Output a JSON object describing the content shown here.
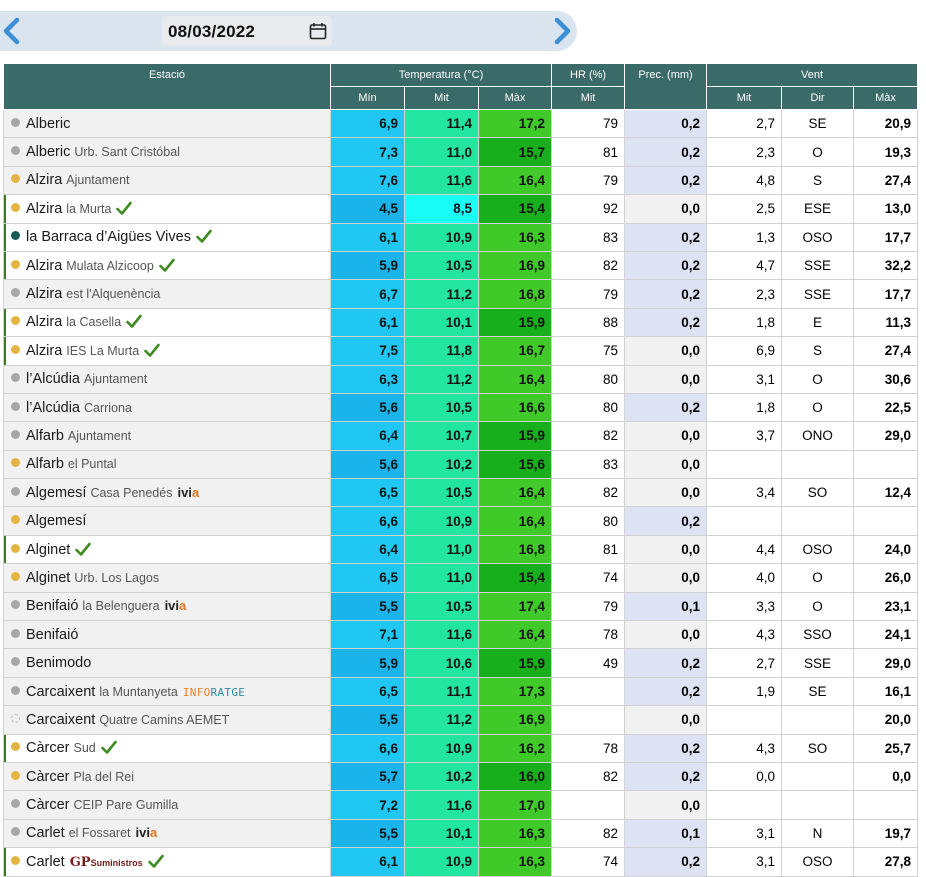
{
  "date": {
    "value": "08/03/2022"
  },
  "icons": {
    "prev": "chevron-left-icon",
    "next": "chevron-right-icon",
    "calendar": "calendar-icon",
    "check": "check-icon"
  },
  "colors": {
    "header_bg": "#3a6b68",
    "min_scale": [
      "#1ab3ea",
      "#20c7f2",
      "#27d7f4"
    ],
    "mit_scale": [
      "#12e2a0",
      "#22e5a2",
      "#42ec9d",
      "#19fff7"
    ],
    "max_scale": [
      "#17b01c",
      "#3fca2a",
      "#5acf37"
    ],
    "prec_bg": "#dde3f2"
  },
  "headers": {
    "station": "Estació",
    "temperature": "Temperatura (°C)",
    "humidity": "HR (%)",
    "precipitation": "Prec. (mm)",
    "wind": "Vent",
    "min": "Mín",
    "mit": "Mit",
    "max": "Màx",
    "hr_mit": "Mit",
    "wind_mit": "Mit",
    "wind_dir": "Dir",
    "wind_max": "Màx"
  },
  "rows": [
    {
      "town": "Alberic",
      "sub": "",
      "dot": "grey",
      "check": false,
      "brand": "",
      "min": "6,9",
      "mit": "11,4",
      "max": "17,2",
      "hr": "79",
      "prec": "0,2",
      "vmit": "2,7",
      "vdir": "SE",
      "vmax": "20,9",
      "minc": "#20c7f2",
      "mitc": "#22e5a2",
      "maxc": "#3fca2a",
      "precc": "#dde3f2"
    },
    {
      "town": "Alberic",
      "sub": "Urb. Sant Cristóbal",
      "dot": "grey",
      "check": false,
      "brand": "",
      "min": "7,3",
      "mit": "11,0",
      "max": "15,7",
      "hr": "81",
      "prec": "0,2",
      "vmit": "2,3",
      "vdir": "O",
      "vmax": "19,3",
      "minc": "#20c7f2",
      "mitc": "#22e5a2",
      "maxc": "#17b01c",
      "precc": "#dde3f2"
    },
    {
      "town": "Alzira",
      "sub": "Ajuntament",
      "dot": "yellow",
      "check": false,
      "brand": "",
      "min": "7,6",
      "mit": "11,6",
      "max": "16,4",
      "hr": "79",
      "prec": "0,2",
      "vmit": "4,8",
      "vdir": "S",
      "vmax": "27,4",
      "minc": "#20c7f2",
      "mitc": "#22e5a2",
      "maxc": "#3fca2a",
      "precc": "#dde3f2"
    },
    {
      "town": "Alzira",
      "sub": "la Murta",
      "dot": "yellow",
      "check": true,
      "brand": "",
      "min": "4,5",
      "mit": "8,5",
      "max": "15,4",
      "hr": "92",
      "prec": "0,0",
      "vmit": "2,5",
      "vdir": "ESE",
      "vmax": "13,0",
      "minc": "#1ab3ea",
      "mitc": "#19fff7",
      "maxc": "#17b01c",
      "precc": "#f1f1f1"
    },
    {
      "town": "la Barraca d’Aigües Vives",
      "sub": "",
      "dot": "teal",
      "check": true,
      "brand": "",
      "min": "6,1",
      "mit": "10,9",
      "max": "16,3",
      "hr": "83",
      "prec": "0,2",
      "vmit": "1,3",
      "vdir": "OSO",
      "vmax": "17,7",
      "minc": "#20c7f2",
      "mitc": "#22e5a2",
      "maxc": "#3fca2a",
      "precc": "#dde3f2"
    },
    {
      "town": "Alzira",
      "sub": "Mulata Alzicoop",
      "dot": "yellow",
      "check": true,
      "brand": "",
      "min": "5,9",
      "mit": "10,5",
      "max": "16,9",
      "hr": "82",
      "prec": "0,2",
      "vmit": "4,7",
      "vdir": "SSE",
      "vmax": "32,2",
      "minc": "#1ab3ea",
      "mitc": "#22e5a2",
      "maxc": "#3fca2a",
      "precc": "#dde3f2"
    },
    {
      "town": "Alzira",
      "sub": "est l'Alquenència",
      "dot": "grey",
      "check": false,
      "brand": "",
      "min": "6,7",
      "mit": "11,2",
      "max": "16,8",
      "hr": "79",
      "prec": "0,2",
      "vmit": "2,3",
      "vdir": "SSE",
      "vmax": "17,7",
      "minc": "#20c7f2",
      "mitc": "#22e5a2",
      "maxc": "#3fca2a",
      "precc": "#dde3f2"
    },
    {
      "town": "Alzira",
      "sub": "la Casella",
      "dot": "yellow",
      "check": true,
      "brand": "",
      "min": "6,1",
      "mit": "10,1",
      "max": "15,9",
      "hr": "88",
      "prec": "0,2",
      "vmit": "1,8",
      "vdir": "E",
      "vmax": "11,3",
      "minc": "#20c7f2",
      "mitc": "#22e5a2",
      "maxc": "#17b01c",
      "precc": "#dde3f2"
    },
    {
      "town": "Alzira",
      "sub": "IES La Murta",
      "dot": "yellow",
      "check": true,
      "brand": "",
      "min": "7,5",
      "mit": "11,8",
      "max": "16,7",
      "hr": "75",
      "prec": "0,0",
      "vmit": "6,9",
      "vdir": "S",
      "vmax": "27,4",
      "minc": "#20c7f2",
      "mitc": "#22e5a2",
      "maxc": "#3fca2a",
      "precc": "#f1f1f1"
    },
    {
      "town": "l’Alcúdia",
      "sub": "Ajuntament",
      "dot": "grey",
      "check": false,
      "brand": "",
      "min": "6,3",
      "mit": "11,2",
      "max": "16,4",
      "hr": "80",
      "prec": "0,0",
      "vmit": "3,1",
      "vdir": "O",
      "vmax": "30,6",
      "minc": "#20c7f2",
      "mitc": "#22e5a2",
      "maxc": "#3fca2a",
      "precc": "#f1f1f1"
    },
    {
      "town": "l’Alcúdia",
      "sub": "Carriona",
      "dot": "grey",
      "check": false,
      "brand": "",
      "min": "5,6",
      "mit": "10,5",
      "max": "16,6",
      "hr": "80",
      "prec": "0,2",
      "vmit": "1,8",
      "vdir": "O",
      "vmax": "22,5",
      "minc": "#1ab3ea",
      "mitc": "#22e5a2",
      "maxc": "#3fca2a",
      "precc": "#dde3f2"
    },
    {
      "town": "Alfarb",
      "sub": "Ajuntament",
      "dot": "grey",
      "check": false,
      "brand": "",
      "min": "6,4",
      "mit": "10,7",
      "max": "15,9",
      "hr": "82",
      "prec": "0,0",
      "vmit": "3,7",
      "vdir": "ONO",
      "vmax": "29,0",
      "minc": "#20c7f2",
      "mitc": "#22e5a2",
      "maxc": "#17b01c",
      "precc": "#f1f1f1"
    },
    {
      "town": "Alfarb",
      "sub": "el Puntal",
      "dot": "yellow",
      "check": false,
      "brand": "",
      "min": "5,6",
      "mit": "10,2",
      "max": "15,6",
      "hr": "83",
      "prec": "0,0",
      "vmit": "",
      "vdir": "",
      "vmax": "",
      "minc": "#1ab3ea",
      "mitc": "#22e5a2",
      "maxc": "#17b01c",
      "precc": "#f1f1f1"
    },
    {
      "town": "Algemesí",
      "sub": "Casa Penedés",
      "dot": "grey",
      "check": false,
      "brand": "ivia",
      "min": "6,5",
      "mit": "10,5",
      "max": "16,4",
      "hr": "82",
      "prec": "0,0",
      "vmit": "3,4",
      "vdir": "SO",
      "vmax": "12,4",
      "minc": "#20c7f2",
      "mitc": "#22e5a2",
      "maxc": "#3fca2a",
      "precc": "#f1f1f1"
    },
    {
      "town": "Algemesí",
      "sub": "",
      "dot": "yellow",
      "check": false,
      "brand": "",
      "min": "6,6",
      "mit": "10,9",
      "max": "16,4",
      "hr": "80",
      "prec": "0,2",
      "vmit": "",
      "vdir": "",
      "vmax": "",
      "minc": "#20c7f2",
      "mitc": "#22e5a2",
      "maxc": "#3fca2a",
      "precc": "#dde3f2"
    },
    {
      "town": "Alginet",
      "sub": "",
      "dot": "yellow",
      "check": true,
      "brand": "",
      "min": "6,4",
      "mit": "11,0",
      "max": "16,8",
      "hr": "81",
      "prec": "0,0",
      "vmit": "4,4",
      "vdir": "OSO",
      "vmax": "24,0",
      "minc": "#20c7f2",
      "mitc": "#22e5a2",
      "maxc": "#3fca2a",
      "precc": "#f1f1f1"
    },
    {
      "town": "Alginet",
      "sub": "Urb. Los Lagos",
      "dot": "yellow",
      "check": false,
      "brand": "",
      "min": "6,5",
      "mit": "11,0",
      "max": "15,4",
      "hr": "74",
      "prec": "0,0",
      "vmit": "4,0",
      "vdir": "O",
      "vmax": "26,0",
      "minc": "#20c7f2",
      "mitc": "#22e5a2",
      "maxc": "#17b01c",
      "precc": "#f1f1f1"
    },
    {
      "town": "Benifaió",
      "sub": "la Belenguera",
      "dot": "grey",
      "check": false,
      "brand": "ivia",
      "min": "5,5",
      "mit": "10,5",
      "max": "17,4",
      "hr": "79",
      "prec": "0,1",
      "vmit": "3,3",
      "vdir": "O",
      "vmax": "23,1",
      "minc": "#1ab3ea",
      "mitc": "#22e5a2",
      "maxc": "#3fca2a",
      "precc": "#dde3f2"
    },
    {
      "town": "Benifaió",
      "sub": "",
      "dot": "grey",
      "check": false,
      "brand": "",
      "min": "7,1",
      "mit": "11,6",
      "max": "16,4",
      "hr": "78",
      "prec": "0,0",
      "vmit": "4,3",
      "vdir": "SSO",
      "vmax": "24,1",
      "minc": "#20c7f2",
      "mitc": "#22e5a2",
      "maxc": "#3fca2a",
      "precc": "#f1f1f1"
    },
    {
      "town": "Benimodo",
      "sub": "",
      "dot": "grey",
      "check": false,
      "brand": "",
      "min": "5,9",
      "mit": "10,6",
      "max": "15,9",
      "hr": "49",
      "prec": "0,2",
      "vmit": "2,7",
      "vdir": "SSE",
      "vmax": "29,0",
      "minc": "#1ab3ea",
      "mitc": "#22e5a2",
      "maxc": "#17b01c",
      "precc": "#dde3f2"
    },
    {
      "town": "Carcaixent",
      "sub": "la Muntanyeta",
      "dot": "grey",
      "check": false,
      "brand": "inforatge",
      "min": "6,5",
      "mit": "11,1",
      "max": "17,3",
      "hr": "",
      "prec": "0,2",
      "vmit": "1,9",
      "vdir": "SE",
      "vmax": "16,1",
      "minc": "#20c7f2",
      "mitc": "#22e5a2",
      "maxc": "#3fca2a",
      "precc": "#dde3f2"
    },
    {
      "town": "Carcaixent",
      "sub": "Quatre Camins AEMET",
      "dot": "hollow",
      "check": false,
      "brand": "",
      "min": "5,5",
      "mit": "11,2",
      "max": "16,9",
      "hr": "",
      "prec": "0,0",
      "vmit": "",
      "vdir": "",
      "vmax": "20,0",
      "minc": "#1ab3ea",
      "mitc": "#22e5a2",
      "maxc": "#3fca2a",
      "precc": "#f1f1f1"
    },
    {
      "town": "Càrcer",
      "sub": "Sud",
      "dot": "yellow",
      "check": true,
      "brand": "",
      "min": "6,6",
      "mit": "10,9",
      "max": "16,2",
      "hr": "78",
      "prec": "0,2",
      "vmit": "4,3",
      "vdir": "SO",
      "vmax": "25,7",
      "minc": "#20c7f2",
      "mitc": "#22e5a2",
      "maxc": "#3fca2a",
      "precc": "#dde3f2"
    },
    {
      "town": "Càrcer",
      "sub": "Pla del Rei",
      "dot": "yellow",
      "check": false,
      "brand": "",
      "min": "5,7",
      "mit": "10,2",
      "max": "16,0",
      "hr": "82",
      "prec": "0,2",
      "vmit": "0,0",
      "vdir": "",
      "vmax": "0,0",
      "minc": "#1ab3ea",
      "mitc": "#22e5a2",
      "maxc": "#17b01c",
      "precc": "#dde3f2"
    },
    {
      "town": "Càrcer",
      "sub": "CEIP Pare Gumilla",
      "dot": "grey",
      "check": false,
      "brand": "",
      "min": "7,2",
      "mit": "11,6",
      "max": "17,0",
      "hr": "",
      "prec": "0,0",
      "vmit": "",
      "vdir": "",
      "vmax": "",
      "minc": "#20c7f2",
      "mitc": "#22e5a2",
      "maxc": "#3fca2a",
      "precc": "#f1f1f1"
    },
    {
      "town": "Carlet",
      "sub": "el Fossaret",
      "dot": "grey",
      "check": false,
      "brand": "ivia",
      "min": "5,5",
      "mit": "10,1",
      "max": "16,3",
      "hr": "82",
      "prec": "0,1",
      "vmit": "3,1",
      "vdir": "N",
      "vmax": "19,7",
      "minc": "#1ab3ea",
      "mitc": "#22e5a2",
      "maxc": "#3fca2a",
      "precc": "#dde3f2"
    },
    {
      "town": "Carlet",
      "sub": "",
      "dot": "yellow",
      "check": true,
      "brand": "gp",
      "min": "6,1",
      "mit": "10,9",
      "max": "16,3",
      "hr": "74",
      "prec": "0,2",
      "vmit": "3,1",
      "vdir": "OSO",
      "vmax": "27,8",
      "minc": "#20c7f2",
      "mitc": "#22e5a2",
      "maxc": "#3fca2a",
      "precc": "#dde3f2"
    }
  ],
  "brands": {
    "ivia": {
      "a": "ivi",
      "b": "a"
    },
    "inforatge": {
      "a": "INFO",
      "b": "RATGE"
    },
    "gp": {
      "a": "GP",
      "b": "Suministros"
    }
  }
}
